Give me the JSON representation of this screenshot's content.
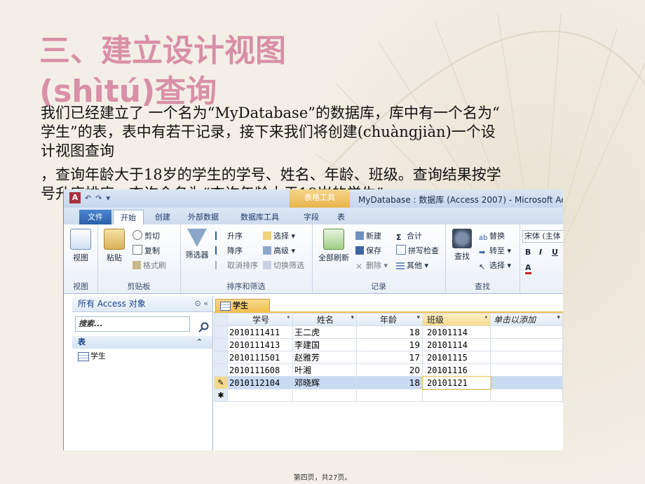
{
  "title": {
    "line1": "三、建立设计视图",
    "line2": "(shìtú)查询"
  },
  "paragraphs": {
    "p1_l1": "我们已经建立了 一个名为“MyDatabase”的数据库，库中有一个名为“",
    "p1_l2": "学生”的表，表中有若干记录，接下来我们将创建(chuàngjiàn)一个设",
    "p1_l3": "计视图查询",
    "p2_l1": "，查询年龄大于18岁的学生的学号、姓名、年龄、班级。查询结果按学",
    "p2_l2": "号升序排序，查询命名为“查询年龄大于18岁的学生”。"
  },
  "access": {
    "app_icon": "A",
    "qat": [
      "↶",
      "↷",
      "▾"
    ],
    "tool_tab_header": "表格工具",
    "window_title": "MyDatabase : 数据库 (Access 2007) - Microsoft Acc",
    "tabs": {
      "file": "文件",
      "home": "开始",
      "create": "创建",
      "external": "外部数据",
      "dbtools": "数据库工具",
      "field": "字段",
      "table": "表"
    },
    "ribbon": {
      "view": {
        "button": "视图",
        "group": "视图"
      },
      "clipboard": {
        "paste": "粘贴",
        "cut": "剪切",
        "copy": "复制",
        "format_painter": "格式刷",
        "group": "剪贴板"
      },
      "sort": {
        "filter": "筛选器",
        "asc": "升序",
        "desc": "降序",
        "remove_sort": "取消排序",
        "selection": "选择 ▾",
        "advanced": "高级 ▾",
        "toggle": "切换筛选",
        "group": "排序和筛选"
      },
      "records": {
        "refresh": "全部刷新",
        "new": "新建",
        "save": "保存",
        "delete": "删除 ▾",
        "totals": "合计",
        "spelling": "拼写检查",
        "more": "其他 ▾",
        "group": "记录"
      },
      "find": {
        "find": "查找",
        "replace": "替换",
        "goto": "转至 ▾",
        "select": "选择 ▾",
        "group": "查找"
      },
      "text": {
        "font": "宋体 (主体",
        "bold": "B",
        "italic": "I",
        "underline": "U"
      }
    },
    "nav": {
      "header": "所有 Access 对象",
      "header_btns": "⊙ «",
      "search_placeholder": "搜索...",
      "group": "表",
      "group_toggle": "⌃",
      "items": [
        "学生"
      ]
    },
    "doc_tab": "学生",
    "columns": {
      "id": "学号",
      "name": "姓名",
      "age": "年龄",
      "class": "班级",
      "add": "单击以添加"
    },
    "rows": [
      {
        "id": "2010111411",
        "name": "王二虎",
        "age": "18",
        "class": "20101114"
      },
      {
        "id": "2010111413",
        "name": "李建国",
        "age": "19",
        "class": "20101114"
      },
      {
        "id": "2010111501",
        "name": "赵雅芳",
        "age": "17",
        "class": "20101115"
      },
      {
        "id": "2010111608",
        "name": "叶湘",
        "age": "20",
        "class": "20101116"
      },
      {
        "id": "2010112104",
        "name": "邓晓辉",
        "age": "18",
        "class": "20101121"
      }
    ],
    "edit_marker": "✎",
    "new_marker": "✱"
  },
  "footer": "第四页，共27页。"
}
